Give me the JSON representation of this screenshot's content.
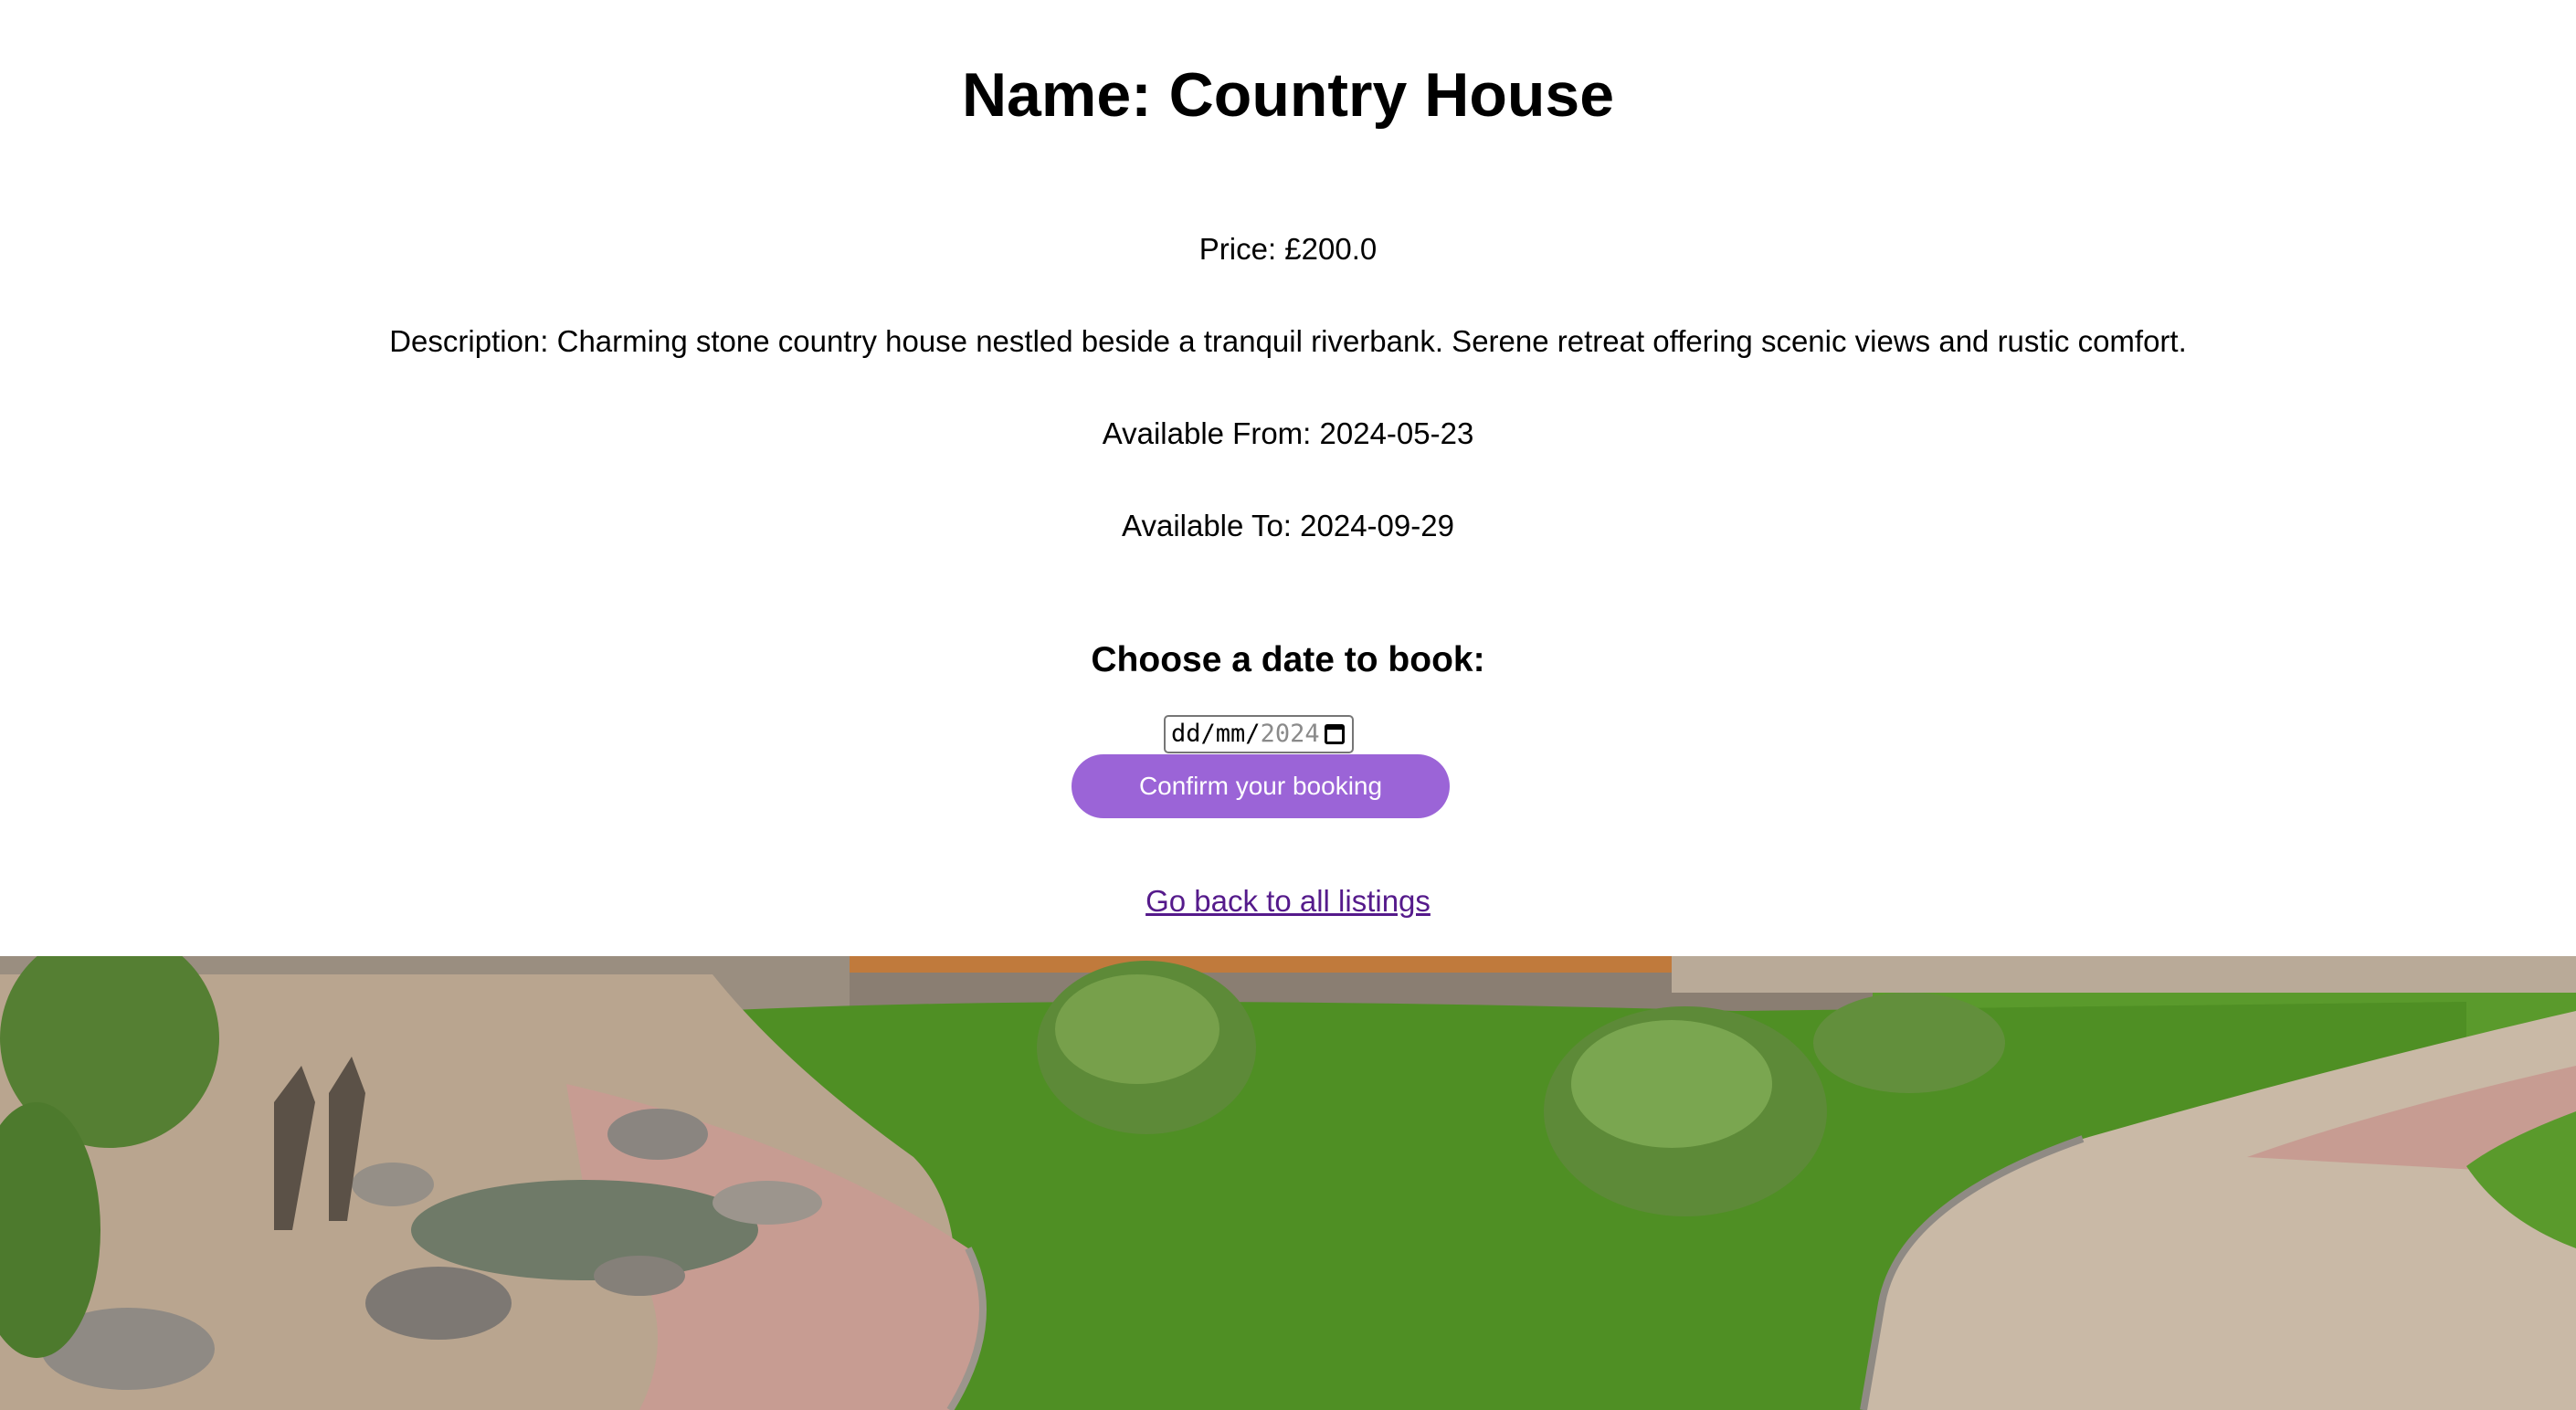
{
  "listing": {
    "title": "Name: Country House",
    "price": "Price: £200.0",
    "description": "Description: Charming stone country house nestled beside a tranquil riverbank. Serene retreat offering scenic views and rustic comfort.",
    "available_from": "Available From: 2024-05-23",
    "available_to": "Available To: 2024-09-29"
  },
  "booking": {
    "heading": "Choose a date to book:",
    "date_input": {
      "day_placeholder": "dd",
      "month_placeholder": "mm",
      "year_value": "2024",
      "separator": "/"
    },
    "confirm_label": "Confirm your booking"
  },
  "navigation": {
    "back_link": "Go back to all listings"
  },
  "hero_image": {
    "icon": "garden-landscape-photo"
  },
  "colors": {
    "button_bg": "#9b64d7",
    "link": "#551a8b",
    "lawn": "#4f8f24",
    "paving": "#c9b9a6"
  }
}
